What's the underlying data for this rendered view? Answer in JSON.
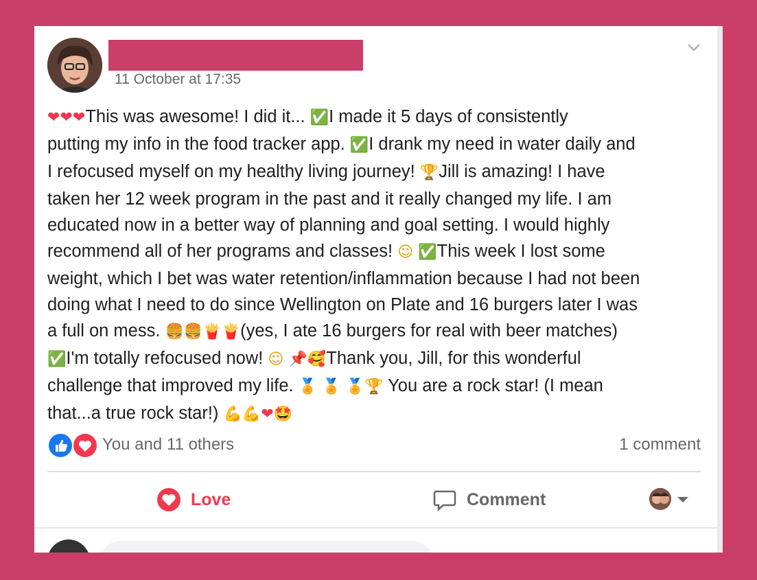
{
  "post": {
    "timestamp": "11 October at 17:35",
    "lines": [
      [
        {
          "e": "heart"
        },
        {
          "e": "heart"
        },
        {
          "e": "heart"
        },
        {
          "t": "This was awesome! I did it... "
        },
        {
          "e": "check"
        },
        {
          "t": "I made it 5 days of consistently"
        }
      ],
      [
        {
          "t": "putting my info in the food tracker app. "
        },
        {
          "e": "check"
        },
        {
          "t": "I drank my need in water daily and"
        }
      ],
      [
        {
          "t": "I refocused myself on my healthy living journey! "
        },
        {
          "e": "trophy"
        },
        {
          "t": "Jill is amazing! I have"
        }
      ],
      [
        {
          "t": "taken her 12 week program in the past and it really changed my life. I am"
        }
      ],
      [
        {
          "t": "educated now in a better way of planning and goal setting. I would highly"
        }
      ],
      [
        {
          "t": "recommend all of her programs and classes! "
        },
        {
          "e": "smile"
        },
        {
          "t": " "
        },
        {
          "e": "check"
        },
        {
          "t": "This week I lost some"
        }
      ],
      [
        {
          "t": "weight, which I bet was water retention/inflammation because I had not been"
        }
      ],
      [
        {
          "t": "doing what I need to do since Wellington on Plate and 16 burgers later I was"
        }
      ],
      [
        {
          "t": "a full on mess. "
        },
        {
          "e": "burger"
        },
        {
          "e": "burger"
        },
        {
          "e": "fries"
        },
        {
          "e": "fries"
        },
        {
          "t": "(yes, I ate 16 burgers for real with beer matches)"
        }
      ],
      [
        {
          "e": "check"
        },
        {
          "t": "I'm totally refocused now! "
        },
        {
          "e": "smile"
        },
        {
          "t": " "
        },
        {
          "e": "pin"
        },
        {
          "e": "hearts-face"
        },
        {
          "t": "Thank you, Jill, for this wonderful"
        }
      ],
      [
        {
          "t": "challenge that improved my life. "
        },
        {
          "e": "medal"
        },
        {
          "t": " "
        },
        {
          "e": "medal"
        },
        {
          "t": " "
        },
        {
          "e": "medal"
        },
        {
          "e": "trophy"
        },
        {
          "t": " You are a rock star! (I mean"
        }
      ],
      [
        {
          "t": "that...a true rock star!) "
        },
        {
          "e": "muscle"
        },
        {
          "e": "muscle"
        },
        {
          "e": "heart"
        },
        {
          "e": "star-eyes"
        }
      ]
    ]
  },
  "reactions": {
    "summary": "You and 11 others",
    "comment_count": "1 comment",
    "icons": [
      "like-icon",
      "love-icon"
    ]
  },
  "actions": {
    "love_label": "Love",
    "comment_label": "Comment"
  },
  "colors": {
    "background": "#c93f6a",
    "love": "#f0384f",
    "like": "#1877f2",
    "check": "#4caf50"
  }
}
